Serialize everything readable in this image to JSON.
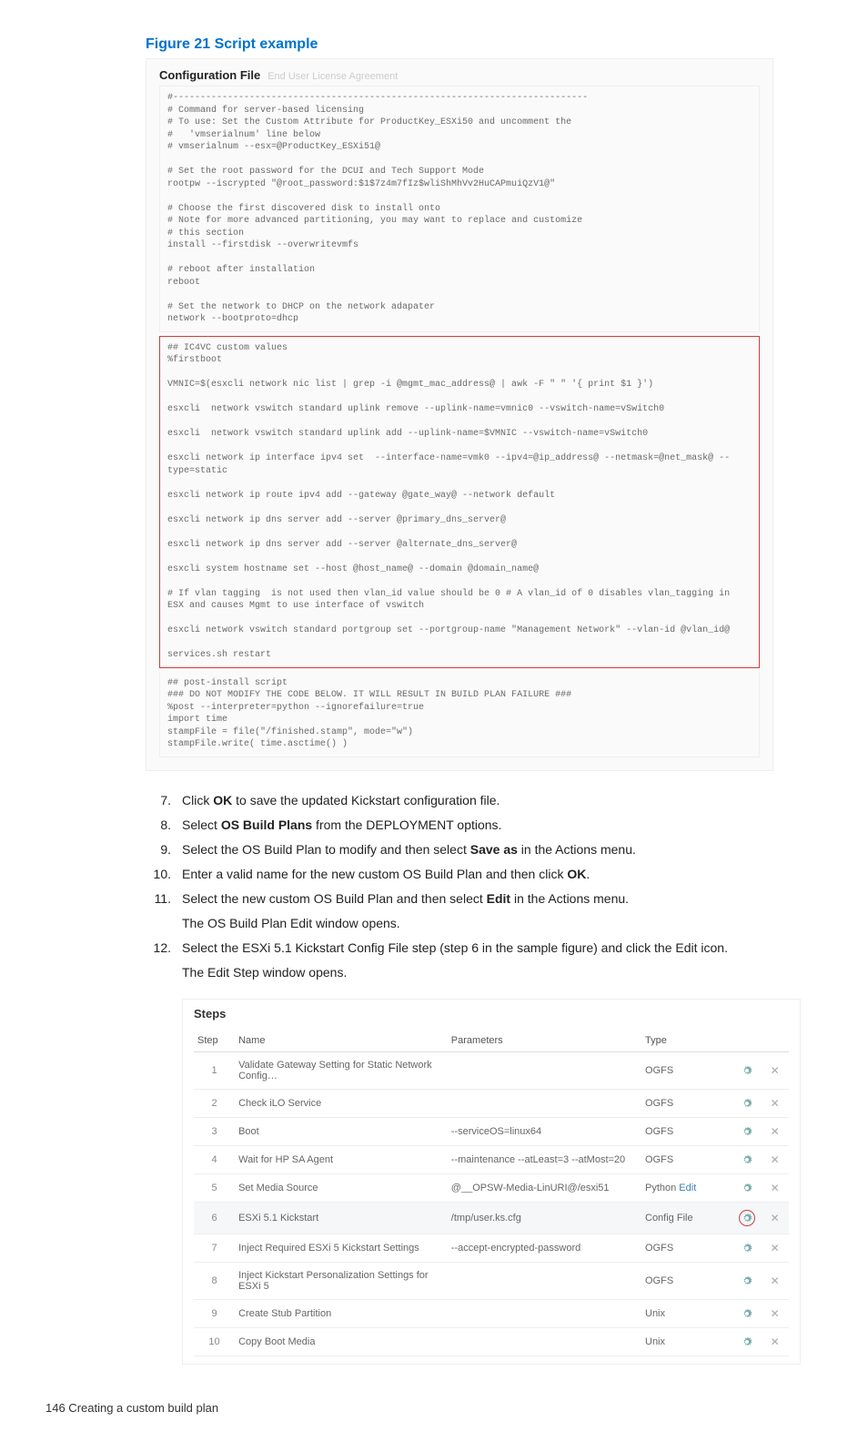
{
  "figure_title": "Figure 21 Script example",
  "conf_label": "Configuration File",
  "faded": "End User License Agreement",
  "code_top": "#----------------------------------------------------------------------------\n# Command for server-based licensing\n# To use: Set the Custom Attribute for ProductKey_ESXi50 and uncomment the\n#   'vmserialnum' line below\n# vmserialnum --esx=@ProductKey_ESXi51@\n\n# Set the root password for the DCUI and Tech Support Mode\nrootpw --iscrypted \"@root_password:$1$7z4m7fIz$wliShMhVv2HuCAPmuiQzV1@\"\n\n# Choose the first discovered disk to install onto\n# Note for more advanced partitioning, you may want to replace and customize\n# this section\ninstall --firstdisk --overwritevmfs\n\n# reboot after installation\nreboot\n\n# Set the network to DHCP on the network adapater\nnetwork --bootproto=dhcp",
  "code_mid": "## IC4VC custom values\n%firstboot\n\nVMNIC=$(esxcli network nic list | grep -i @mgmt_mac_address@ | awk -F \" \" '{ print $1 }')\n\nesxcli  network vswitch standard uplink remove --uplink-name=vmnic0 --vswitch-name=vSwitch0\n\nesxcli  network vswitch standard uplink add --uplink-name=$VMNIC --vswitch-name=vSwitch0\n\nesxcli network ip interface ipv4 set  --interface-name=vmk0 --ipv4=@ip_address@ --netmask=@net_mask@ --type=static\n\nesxcli network ip route ipv4 add --gateway @gate_way@ --network default\n\nesxcli network ip dns server add --server @primary_dns_server@\n\nesxcli network ip dns server add --server @alternate_dns_server@\n\nesxcli system hostname set --host @host_name@ --domain @domain_name@\n\n# If vlan tagging  is not used then vlan_id value should be 0 # A vlan_id of 0 disables vlan_tagging in ESX and causes Mgmt to use interface of vswitch\n\nesxcli network vswitch standard portgroup set --portgroup-name \"Management Network\" --vlan-id @vlan_id@\n\nservices.sh restart",
  "code_bot": "## post-install script\n### DO NOT MODIFY THE CODE BELOW. IT WILL RESULT IN BUILD PLAN FAILURE ###\n%post --interpreter=python --ignorefailure=true\nimport time\nstampFile = file(\"/finished.stamp\", mode=\"w\")\nstampFile.write( time.asctime() )",
  "steps": [
    {
      "n": "7.",
      "t": "Click <b>OK</b> to save the updated Kickstart configuration file."
    },
    {
      "n": "8.",
      "t": "Select <b>OS Build Plans</b> from the DEPLOYMENT options."
    },
    {
      "n": "9.",
      "t": "Select the OS Build Plan to modify and then select <b>Save as</b> in the Actions menu."
    },
    {
      "n": "10.",
      "t": "Enter a valid name for the new custom OS Build Plan and then click <b>OK</b>."
    },
    {
      "n": "11.",
      "t": "Select the new custom OS Build Plan and then select <b>Edit</b> in the Actions menu.",
      "after": "The OS Build Plan Edit window opens."
    },
    {
      "n": "12.",
      "t": "Select the ESXi 5.1 Kickstart Config File step (step 6 in the sample figure) and click the Edit icon.",
      "after": "The Edit Step window opens."
    }
  ],
  "table_title": "Steps",
  "columns": [
    "Step",
    "Name",
    "Parameters",
    "Type"
  ],
  "rows": [
    {
      "step": "1",
      "name": "Validate Gateway Setting for Static Network Config…",
      "params": "",
      "type": "OGFS"
    },
    {
      "step": "2",
      "name": "Check iLO Service",
      "params": "",
      "type": "OGFS"
    },
    {
      "step": "3",
      "name": "Boot",
      "params": "--serviceOS=linux64",
      "type": "OGFS"
    },
    {
      "step": "4",
      "name": "Wait for HP SA Agent",
      "params": "--maintenance --atLeast=3 --atMost=20",
      "type": "OGFS"
    },
    {
      "step": "5",
      "name": "Set Media Source",
      "params": "@__OPSW-Media-LinURI@/esxi51",
      "type": "Python",
      "edit": "Edit"
    },
    {
      "step": "6",
      "name": "ESXi 5.1 Kickstart",
      "params": "/tmp/user.ks.cfg",
      "type": "Config File",
      "hl": true,
      "circle": true
    },
    {
      "step": "7",
      "name": "Inject Required ESXi 5 Kickstart Settings",
      "params": "--accept-encrypted-password",
      "type": "OGFS"
    },
    {
      "step": "8",
      "name": "Inject Kickstart Personalization Settings for ESXi 5",
      "params": "",
      "type": "OGFS"
    },
    {
      "step": "9",
      "name": "Create Stub Partition",
      "params": "",
      "type": "Unix"
    },
    {
      "step": "10",
      "name": "Copy Boot Media",
      "params": "",
      "type": "Unix"
    }
  ],
  "footer": "146   Creating a custom build plan"
}
